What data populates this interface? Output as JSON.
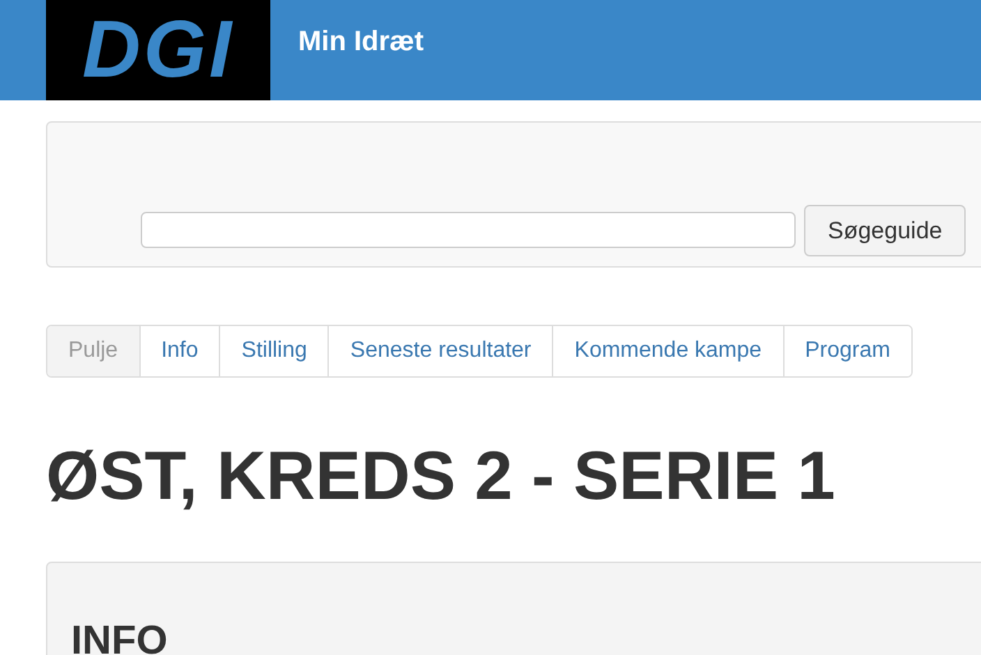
{
  "header": {
    "logo": "DGI",
    "title": "Min Idræt"
  },
  "search": {
    "button": "Søgeguide"
  },
  "tabs": [
    {
      "label": "Pulje",
      "selected": true
    },
    {
      "label": "Info",
      "selected": false
    },
    {
      "label": "Stilling",
      "selected": false
    },
    {
      "label": "Seneste resultater",
      "selected": false
    },
    {
      "label": "Kommende kampe",
      "selected": false
    },
    {
      "label": "Program",
      "selected": false
    }
  ],
  "heading": "ØST, KREDS 2 - SERIE 1",
  "info_panel": {
    "title": "INFO"
  }
}
